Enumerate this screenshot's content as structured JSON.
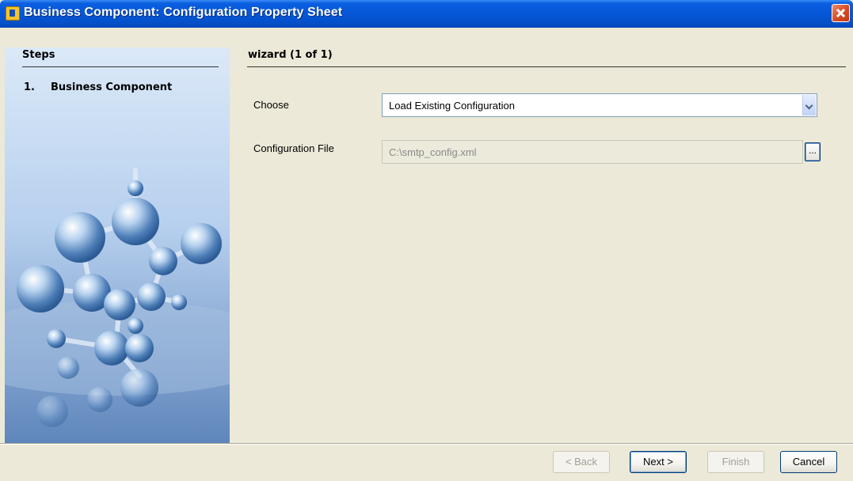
{
  "window": {
    "title": "Business Component: Configuration Property Sheet"
  },
  "steps": {
    "heading": "Steps",
    "items": [
      {
        "number": "1.",
        "label": "Business Component"
      }
    ]
  },
  "wizard": {
    "heading": "wizard (1 of 1)",
    "fields": {
      "choose_label": "Choose",
      "choose_value": "Load Existing Configuration",
      "config_file_label": "Configuration File",
      "config_file_value": "C:\\smtp_config.xml",
      "browse_label": "..."
    }
  },
  "buttons": {
    "back": "< Back",
    "next": "Next >",
    "finish": "Finish",
    "cancel": "Cancel"
  },
  "colors": {
    "titlebar": "#0556d6",
    "dialog_bg": "#ece9d8",
    "close_button": "#d64a22"
  },
  "icons": [
    "app-icon",
    "close-icon",
    "chevron-down-icon",
    "ellipsis-icon"
  ]
}
